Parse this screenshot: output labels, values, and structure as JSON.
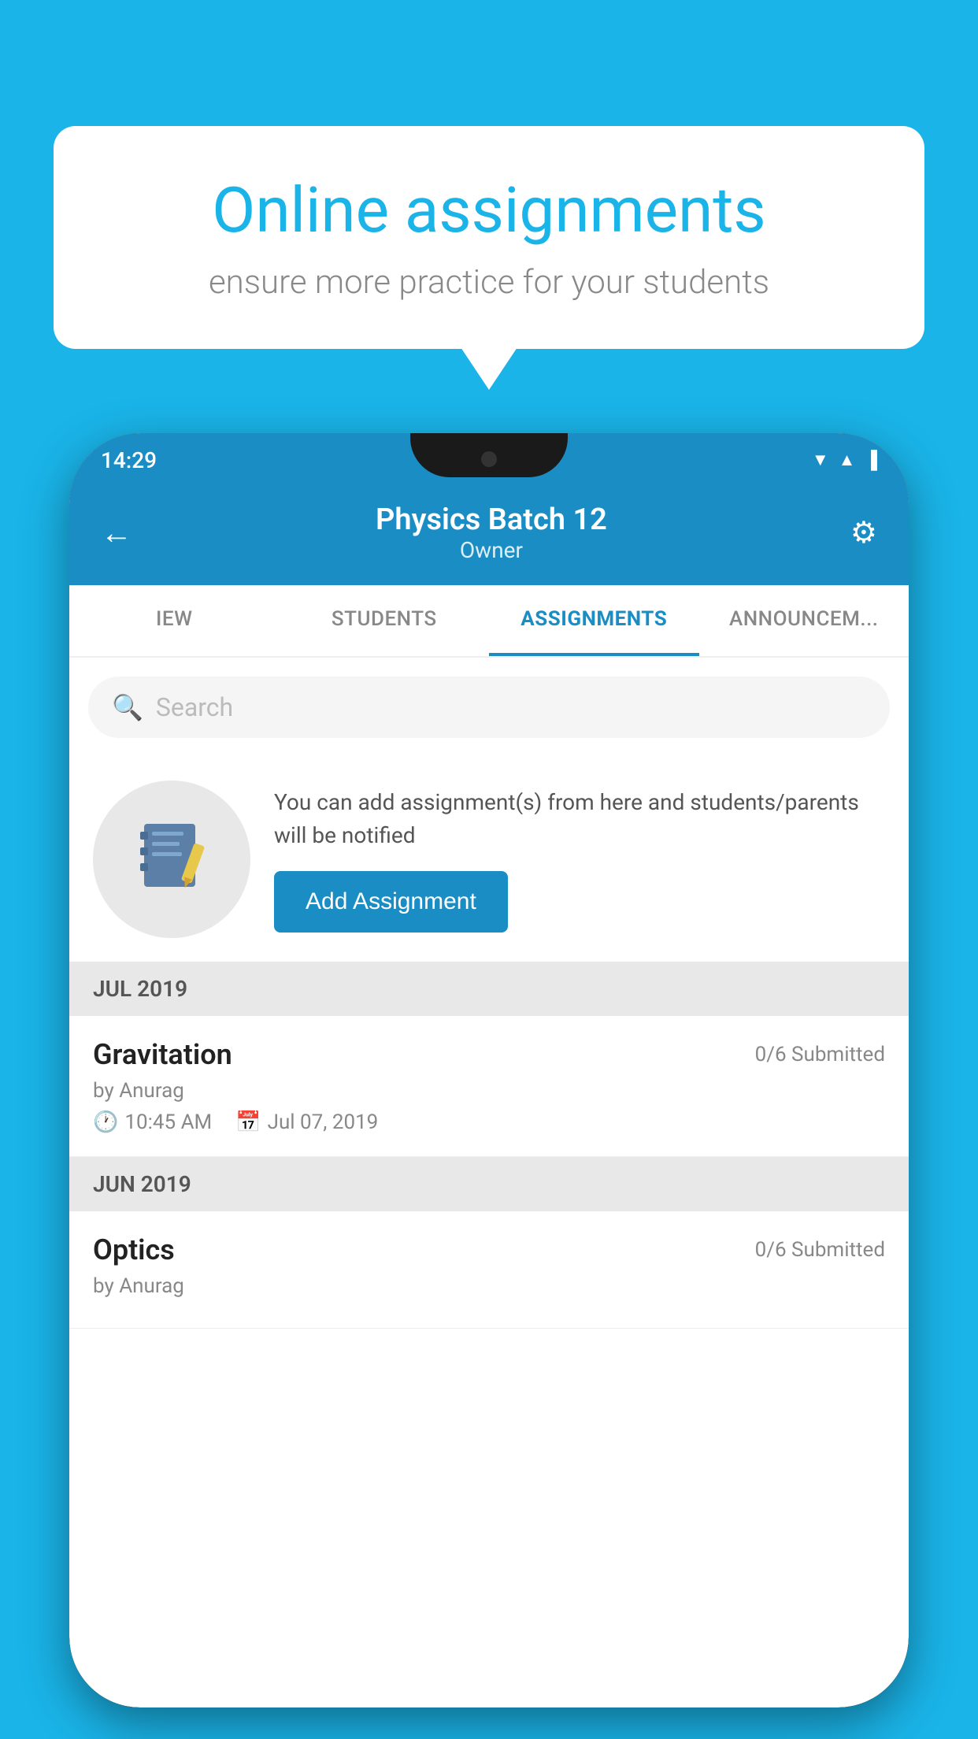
{
  "background_color": "#1ab4e8",
  "speech_bubble": {
    "title": "Online assignments",
    "subtitle": "ensure more practice for your students"
  },
  "status_bar": {
    "time": "14:29"
  },
  "header": {
    "title": "Physics Batch 12",
    "subtitle": "Owner",
    "back_label": "←",
    "settings_label": "⚙"
  },
  "tabs": [
    {
      "label": "IEW",
      "active": false
    },
    {
      "label": "STUDENTS",
      "active": false
    },
    {
      "label": "ASSIGNMENTS",
      "active": true
    },
    {
      "label": "ANNOUNCEMENTS",
      "active": false
    }
  ],
  "search": {
    "placeholder": "Search"
  },
  "promo": {
    "description": "You can add assignment(s) from here and students/parents will be notified",
    "button_label": "Add Assignment"
  },
  "sections": [
    {
      "month": "JUL 2019",
      "assignments": [
        {
          "name": "Gravitation",
          "submitted": "0/6 Submitted",
          "by": "by Anurag",
          "time": "10:45 AM",
          "date": "Jul 07, 2019"
        }
      ]
    },
    {
      "month": "JUN 2019",
      "assignments": [
        {
          "name": "Optics",
          "submitted": "0/6 Submitted",
          "by": "by Anurag",
          "time": "",
          "date": ""
        }
      ]
    }
  ]
}
